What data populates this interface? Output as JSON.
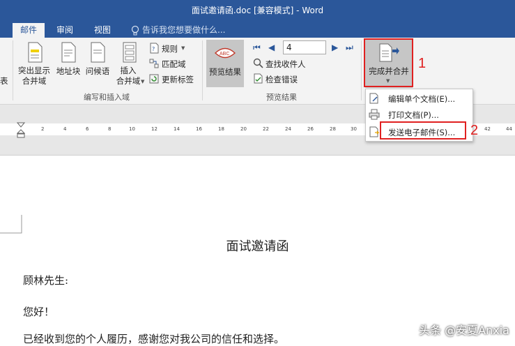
{
  "window": {
    "title": "面试邀请函.doc [兼容模式] - Word"
  },
  "tabs": [
    {
      "label": "邮件",
      "active": true
    },
    {
      "label": "审阅",
      "active": false
    },
    {
      "label": "视图",
      "active": false
    }
  ],
  "tell_me": {
    "placeholder": "告诉我您想要做什么..."
  },
  "ribbon": {
    "partial_left": "表",
    "write_insert": {
      "highlight_fields": "突出显示\n合并域",
      "address_block": "地址块",
      "greeting_line": "问候语",
      "insert_merge_field": "插入\n合并域",
      "rules": "规则",
      "match_fields": "匹配域",
      "update_labels": "更新标签",
      "group_label": "编写和插入域"
    },
    "preview": {
      "preview_results": "预览结果",
      "record_number": "4",
      "find_recipient": "查找收件人",
      "check_errors": "检查错误",
      "group_label": "预览结果"
    },
    "finish": {
      "finish_merge": "完成并合并"
    }
  },
  "menu": {
    "items": [
      {
        "label": "编辑单个文档(E)..."
      },
      {
        "label": "打印文档(P)..."
      },
      {
        "label": "发送电子邮件(S)..."
      }
    ]
  },
  "ruler": {
    "ticks": [
      "2",
      "4",
      "6",
      "8",
      "10",
      "12",
      "14",
      "16",
      "18",
      "20",
      "22",
      "24",
      "26",
      "28",
      "30",
      "42",
      "44"
    ]
  },
  "annotations": {
    "one": "1",
    "two": "2"
  },
  "document": {
    "heading": "面试邀请函",
    "salutation": "顾林先生:",
    "greeting": "您好！",
    "body_line1": "已经收到您的个人履历，感谢您对我公司的信任和选择。"
  },
  "watermark": "头条 @安夏Anxia",
  "colors": {
    "title_bar": "#2b579a",
    "annotation": "#e02020",
    "ribbon_bg": "#f3f3f3"
  }
}
